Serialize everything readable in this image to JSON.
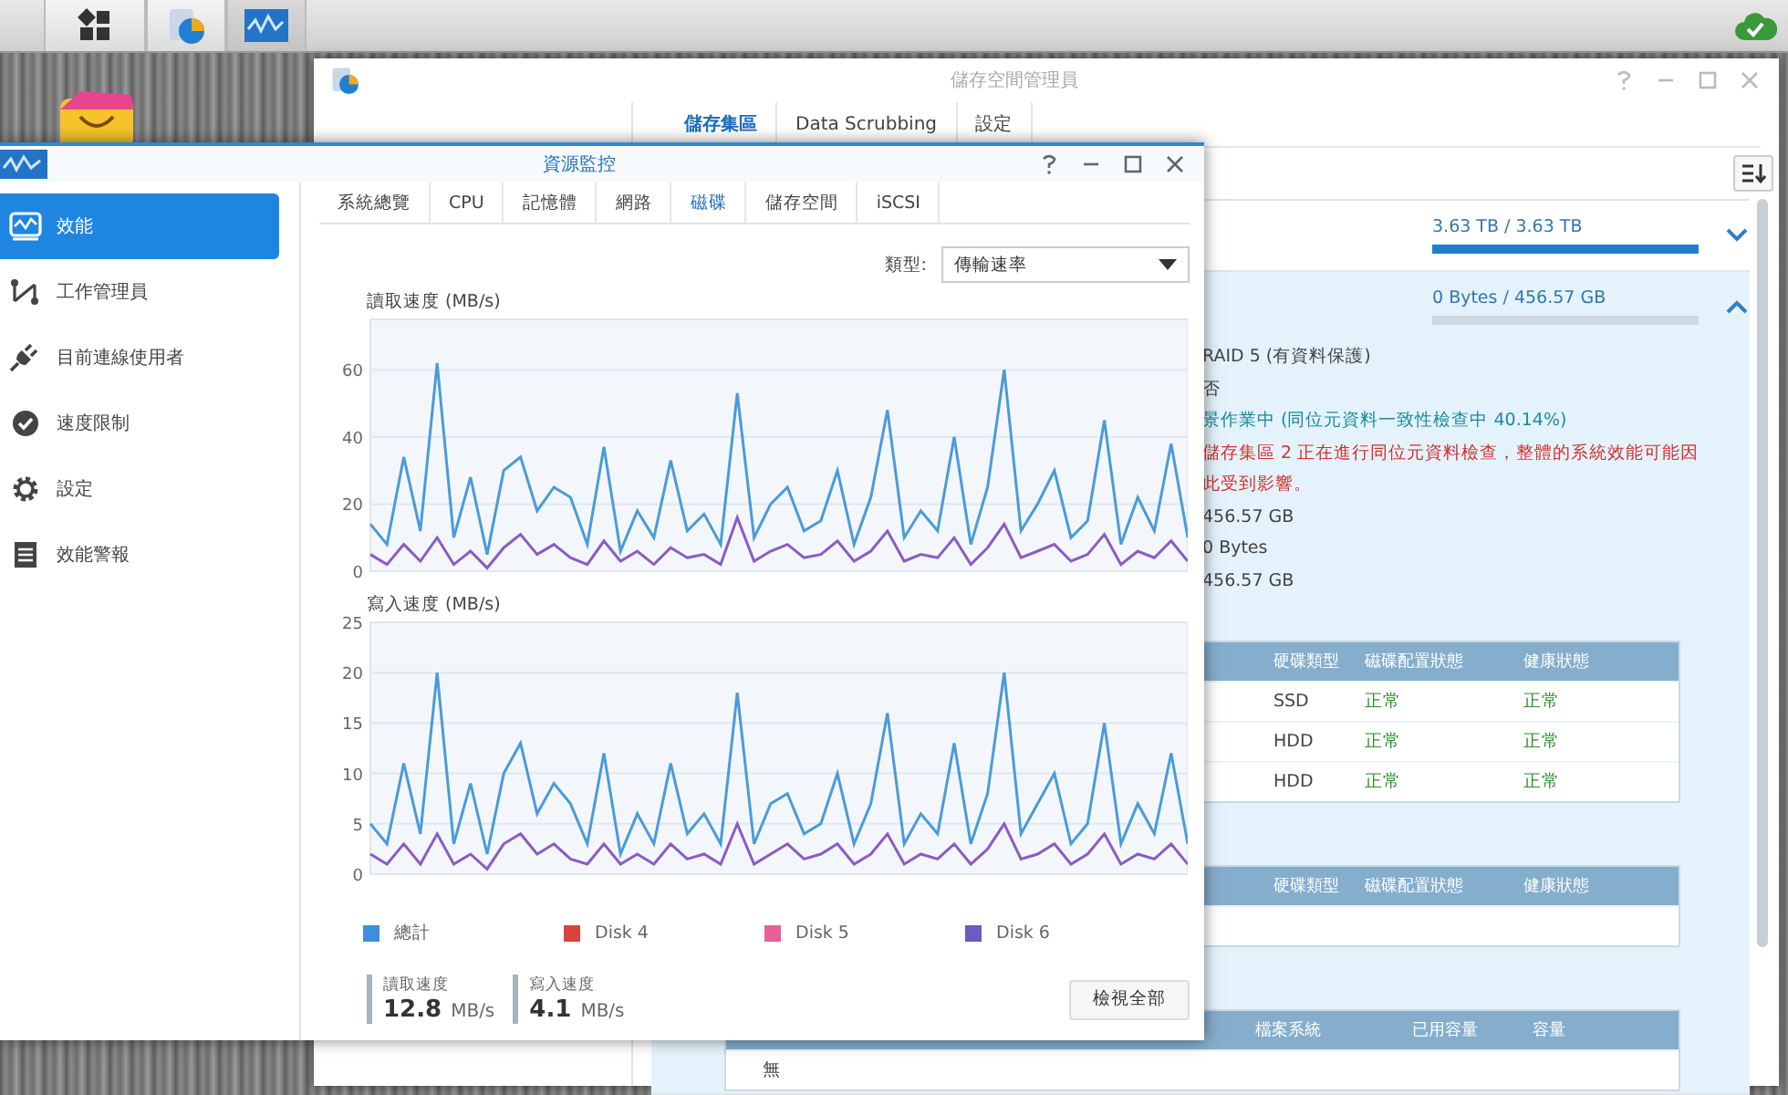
{
  "storage_manager": {
    "title": "儲存空間管理員",
    "tabs": [
      {
        "label": "儲存集區",
        "selected": true
      },
      {
        "label": "Data Scrubbing",
        "selected": false
      },
      {
        "label": "設定",
        "selected": false
      }
    ],
    "pools": [
      {
        "usage": "3.63 TB / 3.63 TB",
        "level": 1,
        "expanded": false
      },
      {
        "usage": "0 Bytes / 456.57 GB",
        "level": 0,
        "expanded": true,
        "details": [
          {
            "text": "RAID 5 (有資料保護)",
            "kind": "normal"
          },
          {
            "text": "否",
            "kind": "normal"
          },
          {
            "text": "景作業中 (同位元資料一致性檢查中 40.14%)",
            "kind": "info"
          },
          {
            "text": "儲存集區 2 正在進行同位元資料檢查，整體的系統效能可能因此受到影響。",
            "kind": "warning"
          },
          {
            "text": "456.57 GB",
            "kind": "normal"
          },
          {
            "text": "0 Bytes",
            "kind": "normal"
          },
          {
            "text": "456.57 GB",
            "kind": "normal"
          }
        ]
      }
    ],
    "tables": [
      {
        "columns": [
          {
            "label": "硬碟類型",
            "kind": "text"
          },
          {
            "label": "磁碟配置狀態",
            "kind": "status"
          },
          {
            "label": "健康狀態",
            "kind": "status"
          }
        ],
        "rows": [
          [
            "SSD",
            "正常",
            "正常"
          ],
          [
            "HDD",
            "正常",
            "正常"
          ],
          [
            "HDD",
            "正常",
            "正常"
          ]
        ]
      },
      {
        "columns": [
          {
            "label": "硬碟類型"
          },
          {
            "label": "磁碟配置狀態"
          },
          {
            "label": "健康狀態"
          }
        ]
      },
      {
        "columns": [
          {
            "label": "檔案系統"
          },
          {
            "label": "已用容量"
          },
          {
            "label": "容量"
          }
        ],
        "empty_text": "無"
      }
    ]
  },
  "resource_monitor": {
    "title": "資源監控",
    "sidebar": [
      {
        "label": "效能",
        "selected": true
      },
      {
        "label": "工作管理員",
        "selected": false
      },
      {
        "label": "目前連線使用者",
        "selected": false
      },
      {
        "label": "速度限制",
        "selected": false
      },
      {
        "label": "設定",
        "selected": false
      },
      {
        "label": "效能警報",
        "selected": false
      }
    ],
    "tabs": [
      {
        "label": "系統總覽",
        "selected": false
      },
      {
        "label": "CPU",
        "selected": false
      },
      {
        "label": "記憶體",
        "selected": false
      },
      {
        "label": "網路",
        "selected": false
      },
      {
        "label": "磁碟",
        "selected": true
      },
      {
        "label": "儲存空間",
        "selected": false
      },
      {
        "label": "iSCSI",
        "selected": false
      }
    ],
    "type_select": {
      "label": "類型:",
      "value": "傳輸速率"
    },
    "charts": [
      {
        "chart_data": {
          "type": "line",
          "title": "讀取速度 (MB/s)",
          "ylim": [
            0,
            75
          ],
          "yticks": [
            0,
            20,
            40,
            60
          ],
          "grid": true,
          "series": [
            {
              "color": "#4a9bd9",
              "values": [
                14,
                8,
                34,
                12,
                62,
                10,
                28,
                5,
                30,
                34,
                18,
                25,
                22,
                8,
                37,
                6,
                18,
                10,
                33,
                12,
                17,
                8,
                53,
                10,
                20,
                25,
                12,
                15,
                30,
                8,
                22,
                48,
                10,
                18,
                12,
                40,
                8,
                25,
                60,
                12,
                20,
                30,
                10,
                15,
                45,
                8,
                22,
                12,
                38,
                10
              ]
            },
            {
              "color": "#8a5cc4",
              "values": [
                5,
                2,
                8,
                3,
                10,
                2,
                6,
                1,
                7,
                11,
                5,
                8,
                4,
                2,
                9,
                3,
                6,
                2,
                7,
                4,
                5,
                2,
                16,
                3,
                6,
                8,
                4,
                5,
                9,
                3,
                6,
                12,
                3,
                5,
                4,
                10,
                2,
                7,
                14,
                4,
                6,
                8,
                3,
                5,
                11,
                2,
                6,
                4,
                9,
                3
              ]
            }
          ]
        }
      },
      {
        "chart_data": {
          "type": "line",
          "title": "寫入速度 (MB/s)",
          "ylim": [
            0,
            25
          ],
          "yticks": [
            0,
            5,
            10,
            15,
            20,
            25
          ],
          "grid": true,
          "series": [
            {
              "color": "#4a9bd9",
              "values": [
                5,
                3,
                11,
                4,
                20,
                3,
                9,
                2,
                10,
                13,
                6,
                9,
                7,
                3,
                12,
                2,
                6,
                3,
                11,
                4,
                6,
                3,
                18,
                3,
                7,
                8,
                4,
                5,
                10,
                3,
                7,
                16,
                3,
                6,
                4,
                13,
                3,
                8,
                20,
                4,
                7,
                10,
                3,
                5,
                15,
                3,
                7,
                4,
                12,
                3
              ]
            },
            {
              "color": "#8a5cc4",
              "values": [
                2,
                1,
                3,
                1,
                4,
                1,
                2,
                0.5,
                3,
                4,
                2,
                3,
                1.5,
                1,
                3,
                1,
                2,
                1,
                3,
                1.5,
                2,
                1,
                5,
                1,
                2,
                3,
                1.5,
                2,
                3,
                1,
                2,
                4,
                1,
                2,
                1.5,
                3,
                1,
                2.5,
                5,
                1.5,
                2,
                3,
                1,
                2,
                4,
                1,
                2,
                1.5,
                3,
                1
              ]
            }
          ]
        }
      }
    ],
    "legend": [
      {
        "label": "總計",
        "color": "#3d8fdc"
      },
      {
        "label": "Disk 4",
        "color": "#d9433c"
      },
      {
        "label": "Disk 5",
        "color": "#e8609a"
      },
      {
        "label": "Disk 6",
        "color": "#6a5cc0"
      }
    ],
    "stats": [
      {
        "label": "讀取速度",
        "value": "12.8",
        "unit": "MB/s"
      },
      {
        "label": "寫入速度",
        "value": "4.1",
        "unit": "MB/s"
      }
    ],
    "button": "檢視全部"
  }
}
